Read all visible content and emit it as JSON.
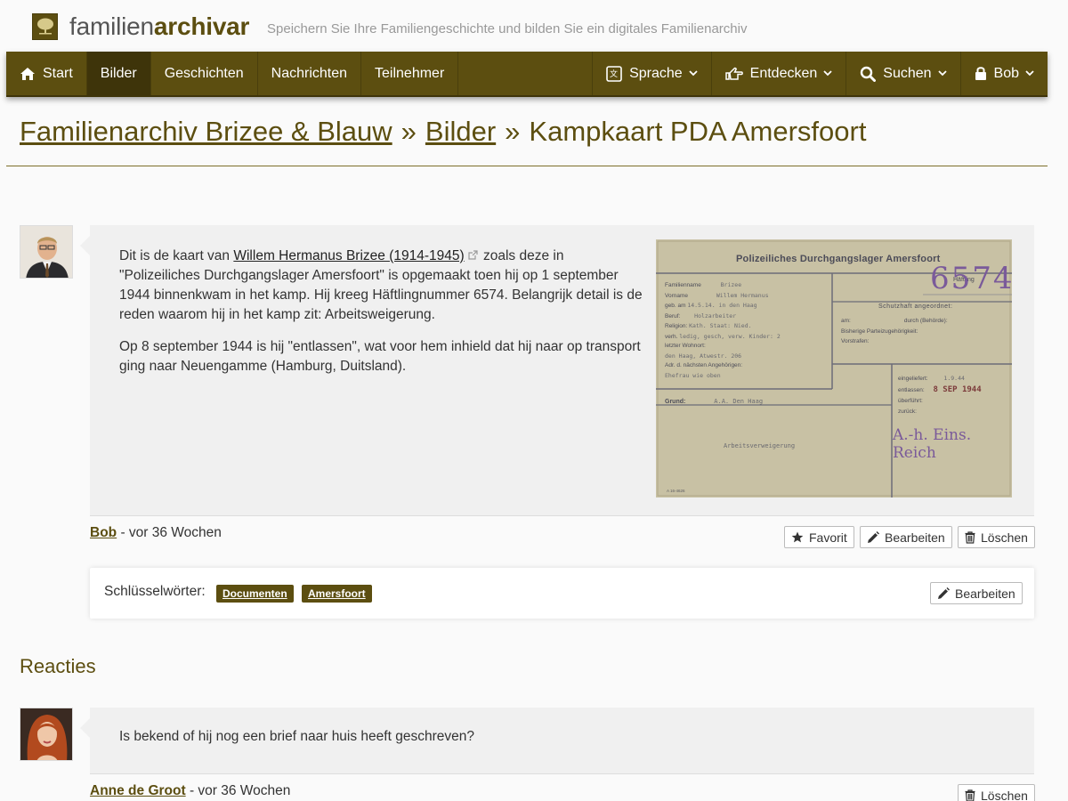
{
  "brand": {
    "name_light": "familien",
    "name_bold": "archivar",
    "tagline": "Speichern Sie Ihre Familiengeschichte und bilden Sie ein digitales Familienarchiv"
  },
  "nav": {
    "left": [
      {
        "label": "Start",
        "icon": "home-icon"
      },
      {
        "label": "Bilder",
        "active": true
      },
      {
        "label": "Geschichten"
      },
      {
        "label": "Nachrichten"
      },
      {
        "label": "Teilnehmer"
      }
    ],
    "right": [
      {
        "label": "Sprache",
        "icon": "translate-icon"
      },
      {
        "label": "Entdecken",
        "icon": "hand-pointer-icon"
      },
      {
        "label": "Suchen",
        "icon": "search-icon"
      },
      {
        "label": "Bob",
        "icon": "lock-icon"
      }
    ]
  },
  "breadcrumb": {
    "archive": "Familienarchiv Brizee & Blauw",
    "section": "Bilder",
    "separator": "»",
    "current": "Kampkaart PDA Amersfoort"
  },
  "post": {
    "p1_before": "Dit is de kaart van ",
    "p1_link": "Willem Hermanus Brizee (1914-1945)",
    "p1_after": " zoals deze in \"Polizeiliches Durchgangslager Amersfoort\" is opgemaakt toen hij op 1 september 1944 binnenkwam in het kamp. Hij kreeg Häftlingnummer 6574. Belangrijk detail is de reden waarom hij in het kamp zit: Arbeitsweigerung.",
    "p2": "Op 8 september 1944 is hij \"entlassen\", wat voor hem inhield dat hij naar op transport ging naar Neuengamme (Hamburg, Duitsland).",
    "author": "Bob",
    "time": " - vor 36 Wochen",
    "btn_favorite": "Favorit",
    "btn_edit": "Bearbeiten",
    "btn_delete": "Löschen"
  },
  "card": {
    "title": "Polizeiliches Durchgangslager Amersfoort",
    "number": "6574",
    "haeftling_label": "Häftling",
    "rows": [
      "Familienname",
      "Vorname",
      "geb. am",
      "Beruf:",
      "Religion:",
      "verh.",
      "letzter Wohnort:",
      "Adr. d. nächsten Angehörigen:"
    ],
    "values": [
      "Brizee",
      "Willem Hermanus",
      "14.5.14. in den Haag",
      "Holzarbeiter",
      "Kath.   Staat: Nied.",
      "ledig, gesch, verw.   Kinder: 2",
      "",
      "den Haag, Atwestr. 206",
      "Ehefrau wie oben"
    ],
    "right_header": "Schutzhaft angeordnet:",
    "right_rows": [
      "am:",
      "durch (Behörde):",
      "Bisherige Parteizugehörigkeit:",
      "Vorstrafen:"
    ],
    "in_rows": [
      "eingeliefert:",
      "entlassen:",
      "überführt:",
      "zurück:"
    ],
    "in_values": [
      "1.9.44",
      "8 SEP 1944",
      "",
      ""
    ],
    "grund_label": "Grund:",
    "grund_value": "A.A. Den Haag",
    "reason": "Arbeitsverweigerung",
    "stamp": "A.-h. Eins. Reich",
    "footer": "A 16-4626"
  },
  "keywords": {
    "label": "Schlüsselwörter:",
    "tags": [
      "Documenten",
      "Amersfoort"
    ],
    "edit": "Bearbeiten"
  },
  "comments": {
    "title": "Reacties",
    "items": [
      {
        "text": "Is bekend of hij nog een brief naar huis heeft geschreven?",
        "author": "Anne de Groot",
        "time": " - vor 36 Wochen",
        "delete": "Löschen"
      }
    ]
  },
  "colors": {
    "brand": "#5c4e10",
    "brand_dark": "#3e340a",
    "panel": "#f0f0f0"
  }
}
